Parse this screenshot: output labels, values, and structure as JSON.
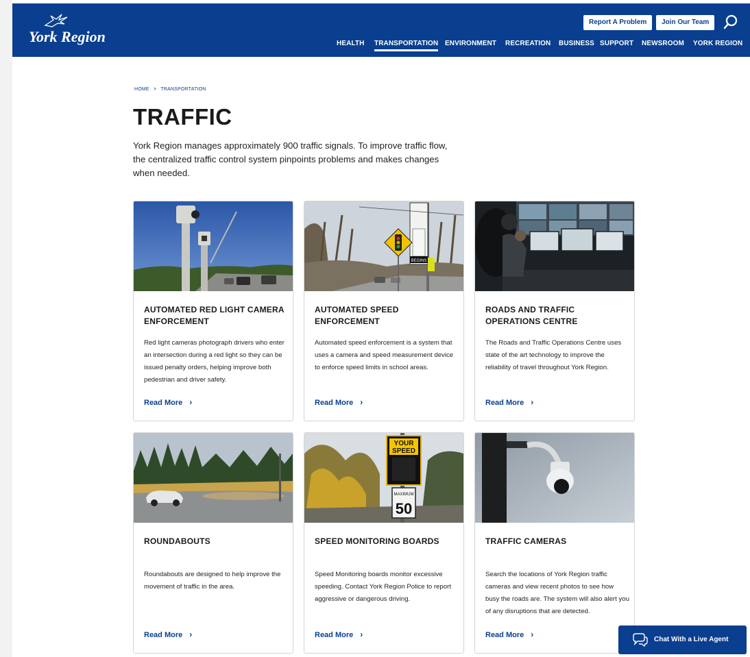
{
  "header": {
    "logo_text": "York Region",
    "report_button": "Report A Problem",
    "join_button": "Join Our Team",
    "nav": [
      "HEALTH",
      "TRANSPORTATION",
      "ENVIRONMENT",
      "RECREATION",
      "BUSINESS",
      "SUPPORT",
      "NEWSROOM",
      "YORK REGION"
    ],
    "active_nav": "TRANSPORTATION"
  },
  "breadcrumb": {
    "home": "HOME",
    "separator": ">",
    "current": "TRANSPORTATION"
  },
  "page": {
    "title": "TRAFFIC",
    "intro": "York Region manages approximately 900 traffic signals. To improve traffic flow, the centralized traffic control system pinpoints problems and makes changes when needed."
  },
  "cards": [
    {
      "title": "AUTOMATED RED LIGHT CAMERA ENFORCEMENT",
      "description": "Red light cameras photograph drivers who enter an intersection during a red light so they can be issued penalty orders, helping improve both pedestrian and driver safety.",
      "link": "Read More"
    },
    {
      "title": "AUTOMATED SPEED ENFORCEMENT",
      "description": "Automated speed enforcement is a system that uses a camera and speed measurement device to enforce speed limits in school areas.",
      "link": "Read More"
    },
    {
      "title": "ROADS AND TRAFFIC OPERATIONS CENTRE",
      "description": "The Roads and Traffic Operations Centre uses state of the art technology to improve the reliability of travel throughout York Region.",
      "link": "Read More"
    },
    {
      "title": "ROUNDABOUTS",
      "description": "Roundabouts are designed to help improve the movement of traffic in the area.",
      "link": "Read More"
    },
    {
      "title": "SPEED MONITORING BOARDS",
      "description": "Speed Monitoring boards monitor excessive speeding. Contact York Region Police to report aggressive or dangerous driving.",
      "link": "Read More"
    },
    {
      "title": "TRAFFIC CAMERAS",
      "description": "Search the locations of York Region traffic cameras and view recent photos to see how busy the roads are. The system will also alert you of any disruptions that are detected.",
      "link": "Read More"
    }
  ],
  "image_text": {
    "speed_sign_top": "YOUR",
    "speed_sign_bottom": "SPEED",
    "max_label": "MAXIMUM",
    "max_value": "50",
    "begins": "BEGINS"
  },
  "chat": {
    "label": "Chat With a Live Agent",
    "icon": "chat-bubbles-icon"
  },
  "colors": {
    "brand_blue": "#0a3f8f",
    "white": "#ffffff"
  },
  "icons": {
    "search": "search-icon",
    "chevron": "chevron-right-icon",
    "logo": "york-region-bird-logo"
  }
}
